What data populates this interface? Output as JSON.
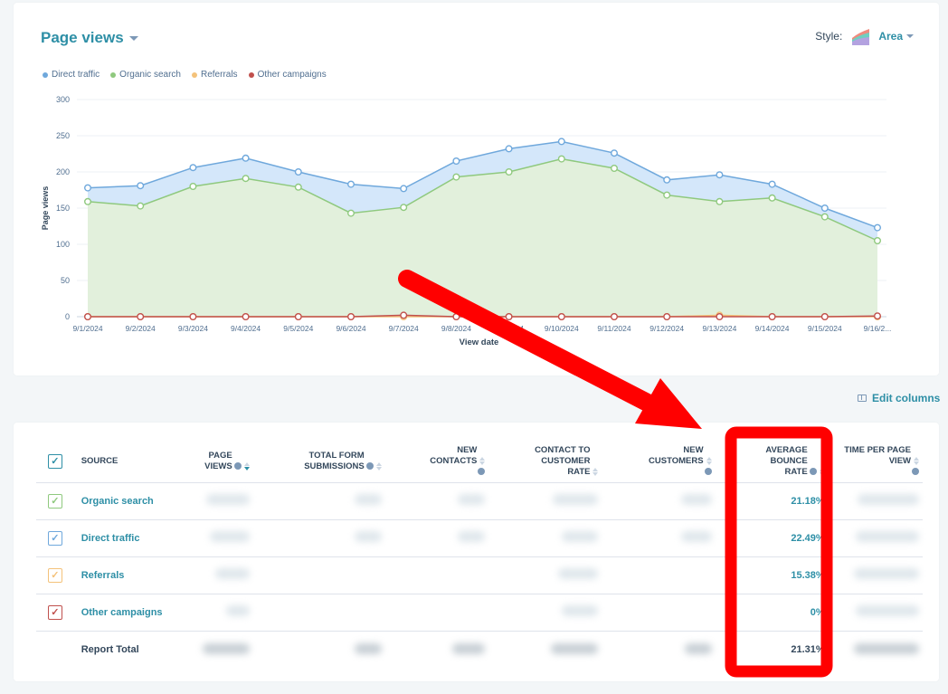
{
  "header": {
    "title": "Page views",
    "style_label": "Style:",
    "style_value": "Area"
  },
  "legend": [
    {
      "label": "Direct traffic",
      "color": "#6fa8dc"
    },
    {
      "label": "Organic search",
      "color": "#8fc97e"
    },
    {
      "label": "Referrals",
      "color": "#f4c27a"
    },
    {
      "label": "Other campaigns",
      "color": "#c0504d"
    }
  ],
  "chart_data": {
    "type": "area",
    "title": "Page views",
    "xlabel": "View date",
    "ylabel": "Page views",
    "ylim": [
      0,
      300
    ],
    "yticks": [
      0,
      50,
      100,
      150,
      200,
      250,
      300
    ],
    "grid": true,
    "legend_position": "top-left",
    "categories": [
      "9/1/2024",
      "9/2/2024",
      "9/3/2024",
      "9/4/2024",
      "9/5/2024",
      "9/6/2024",
      "9/7/2024",
      "9/8/2024",
      "9/9/2024",
      "9/10/2024",
      "9/11/2024",
      "9/12/2024",
      "9/13/2024",
      "9/14/2024",
      "9/15/2024",
      "9/16/2..."
    ],
    "series": [
      {
        "name": "Direct traffic",
        "color": "#6fa8dc",
        "values": [
          178,
          181,
          206,
          219,
          200,
          183,
          177,
          215,
          232,
          242,
          226,
          189,
          196,
          183,
          150,
          123
        ]
      },
      {
        "name": "Organic search",
        "color": "#8fc97e",
        "values": [
          159,
          153,
          180,
          191,
          179,
          143,
          151,
          193,
          200,
          218,
          205,
          168,
          159,
          164,
          138,
          105
        ]
      },
      {
        "name": "Referrals",
        "color": "#f4c27a",
        "values": [
          0,
          0,
          0,
          0,
          0,
          0,
          0,
          0,
          0,
          0,
          0,
          0,
          2,
          0,
          0,
          0
        ]
      },
      {
        "name": "Other campaigns",
        "color": "#c0504d",
        "values": [
          0,
          0,
          0,
          0,
          0,
          0,
          2,
          0,
          0,
          0,
          0,
          0,
          0,
          0,
          0,
          1
        ]
      }
    ]
  },
  "toolbar": {
    "edit_columns_label": "Edit columns"
  },
  "table": {
    "columns": [
      {
        "label": "Source"
      },
      {
        "label": "Page views",
        "info": true,
        "sorted": "desc"
      },
      {
        "label": "Total form submissions",
        "info": true
      },
      {
        "label": "New contacts",
        "info": true
      },
      {
        "label": "Contact to customer rate"
      },
      {
        "label": "New customers",
        "info": true
      },
      {
        "label": "Average bounce rate",
        "info": true
      },
      {
        "label": "Time per page view",
        "info": true
      }
    ],
    "rows": [
      {
        "source": "Organic search",
        "check_color": "#8fc97e",
        "bounce_rate": "21.18%"
      },
      {
        "source": "Direct traffic",
        "check_color": "#6fa8dc",
        "bounce_rate": "22.49%"
      },
      {
        "source": "Referrals",
        "check_color": "#f4c27a",
        "bounce_rate": "15.38%"
      },
      {
        "source": "Other campaigns",
        "check_color": "#c0504d",
        "bounce_rate": "0%"
      }
    ],
    "total": {
      "label": "Report Total",
      "bounce_rate": "21.31%"
    },
    "header_check_color": "#2e8fa6"
  },
  "annotation": {
    "color": "#ff0000",
    "highlighted_column": "Average bounce rate"
  }
}
